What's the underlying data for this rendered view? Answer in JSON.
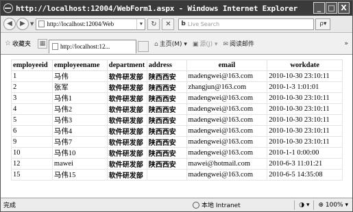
{
  "window": {
    "title": "http://localhost:12004/WebForm1.aspx - Windows Internet Explorer",
    "min": "_",
    "max": "□",
    "close": "X"
  },
  "nav": {
    "back": "◀",
    "forward": "▶",
    "address": "http://localhost:12004/Web",
    "refresh": "↻",
    "stop": "✕",
    "search_placeholder": "Live Search",
    "search_go": "ρ▾"
  },
  "favbar": {
    "favorites_label": "收藏夹",
    "tab_label": "http://localhost:12...",
    "home_label": "主页(M)",
    "feeds_label": "源(J)",
    "mail_label": "阅读邮件",
    "more": "»"
  },
  "table": {
    "columns": [
      "employeeid",
      "employeename",
      "department",
      "address",
      "email",
      "workdate"
    ],
    "rows": [
      [
        "1",
        "马伟",
        "软件研发部",
        "陕西西安",
        "madengwei@163.com",
        "2010-10-30 23:10:11"
      ],
      [
        "2",
        "张军",
        "软件研发部",
        "陕西西安",
        "zhangjun@163.com",
        "2010-1-3 1:01:01"
      ],
      [
        "3",
        "马伟1",
        "软件研发部",
        "陕西西安",
        "madengwei@163.com",
        "2010-10-30 23:10:11"
      ],
      [
        "4",
        "马伟2",
        "软件研发部",
        "陕西西安",
        "madengwei@163.com",
        "2010-10-30 23:10:11"
      ],
      [
        "5",
        "马伟3",
        "软件研发部",
        "陕西西安",
        "madengwei@163.com",
        "2010-10-30 23:10:11"
      ],
      [
        "6",
        "马伟4",
        "软件研发部",
        "陕西西安",
        "madengwei@163.com",
        "2010-10-30 23:10:11"
      ],
      [
        "9",
        "马伟7",
        "软件研发部",
        "陕西西安",
        "madengwei@163.com",
        "2010-10-30 23:10:11"
      ],
      [
        "10",
        "马伟10",
        "软件研发部",
        "陕西西安",
        "madengwei@163.com",
        "2010-1-1 0:00:00"
      ],
      [
        "12",
        "mawei",
        "软件研发部",
        "陕西西安",
        "mawei@hotmail.com",
        "2010-6-3 11:01:21"
      ],
      [
        "15",
        "马伟15",
        "软件研发部",
        "",
        "madengwei@163.com",
        "2010-6-5 14:35:08"
      ]
    ]
  },
  "status": {
    "text": "完成",
    "zone": "本地 Intranet",
    "zoom": "100%"
  }
}
